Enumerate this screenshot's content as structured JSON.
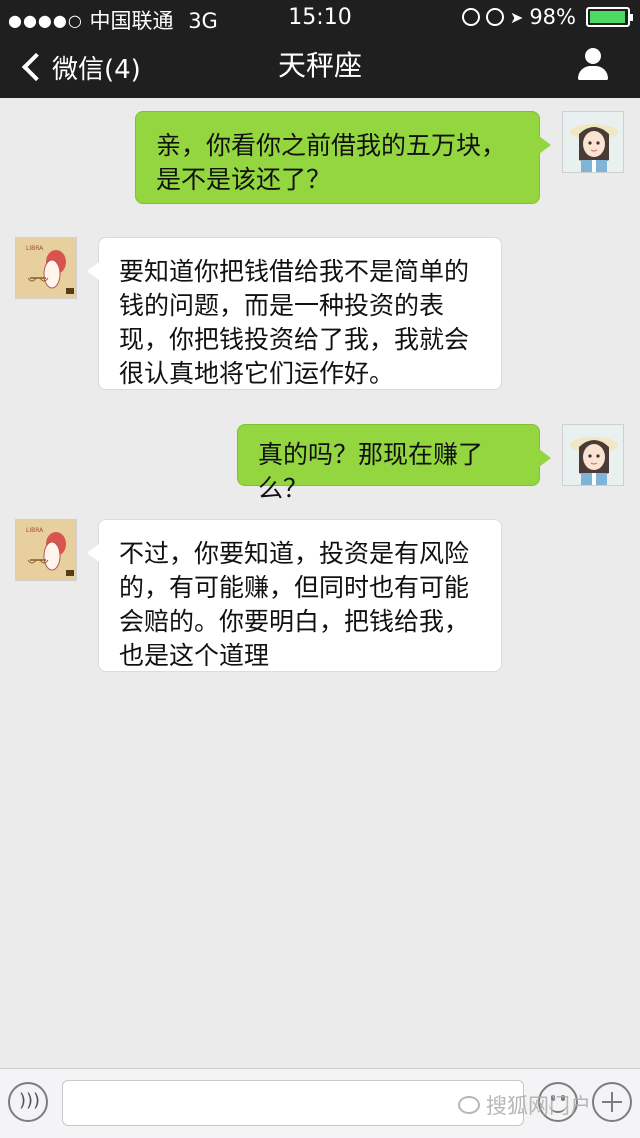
{
  "status_bar": {
    "signal": "●●●●○",
    "carrier": "中国联通",
    "network": "3G",
    "time": "15:10",
    "battery_percent": "98%",
    "battery_level": 0.98,
    "icons": [
      "rotation-lock-icon",
      "alarm-icon",
      "location-icon",
      "battery-icon"
    ]
  },
  "nav": {
    "back_label": "微信(4)",
    "title": "天秤座",
    "icons": [
      "back-chevron-icon",
      "user-profile-icon"
    ]
  },
  "messages": [
    {
      "side": "right",
      "text": "亲，你看你之前借我的五万块，是不是该还了？"
    },
    {
      "side": "left",
      "text": "要知道你把钱借给我不是简单的钱的问题，而是一种投资的表现，你把钱投资给了我，我就会很认真地将它们运作好。"
    },
    {
      "side": "right",
      "text": "真的吗？那现在赚了么？"
    },
    {
      "side": "left",
      "text": "不过，你要知道，投资是有风险的，有可能赚，但同时也有可能会赔的。你要明白，把钱给我，也是这个道理"
    }
  ],
  "avatars": {
    "me": "girl-avatar-icon",
    "contact": "libra-cartoon-avatar-icon",
    "contact_caption": "LIBRA"
  },
  "input_bar": {
    "input_value": "",
    "icons": [
      "voice-icon",
      "emoji-icon",
      "plus-icon"
    ]
  },
  "watermark": {
    "text": "搜狐网门户",
    "icon": "wechat-logo-icon"
  },
  "colors": {
    "bar_background": "#1f1f1f",
    "chat_background": "#ebebeb",
    "sent_bubble": "#93d63f",
    "received_bubble": "#ffffff",
    "battery_fill": "#4cd964"
  }
}
